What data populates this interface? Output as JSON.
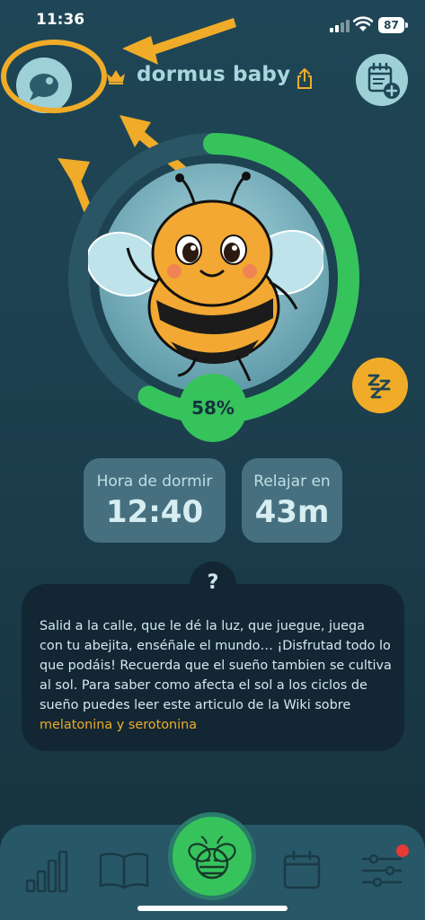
{
  "status_bar": {
    "time": "11:36",
    "battery": "87"
  },
  "header": {
    "title": "dormus baby",
    "chat_icon": "chat-bubble-icon",
    "crown_icon": "crown-icon",
    "share_icon": "share-icon",
    "calendar_add_icon": "calendar-add-icon"
  },
  "progress": {
    "percent_label": "58%",
    "percent_value": 0.58
  },
  "sleep_button": {
    "icon": "zzz-icon"
  },
  "cards": {
    "bedtime": {
      "label": "Hora de dormir",
      "value": "12:40"
    },
    "relax": {
      "label": "Relajar en",
      "value": "43m"
    }
  },
  "tip": {
    "question_mark": "?",
    "text": "Salid a la calle, que le dé la luz, que juegue, juega con tu abejita, enséñale el mundo… ¡Disfrutad todo lo que podáis! Recuerda que el sueño tambien se cultiva al sol. Para saber como afecta el sol a los ciclos de sueño puedes leer este articulo de la Wiki sobre ",
    "link": "melatonina y serotonina"
  },
  "tab_bar": {
    "items": [
      {
        "icon": "stats-icon"
      },
      {
        "icon": "book-icon"
      },
      {
        "icon": "bee-home-icon"
      },
      {
        "icon": "calendar-icon"
      },
      {
        "icon": "settings-sliders-icon"
      }
    ]
  },
  "colors": {
    "accent_green": "#36c35c",
    "accent_orange": "#f0ac28",
    "bg_teal": "#1f4656",
    "notification": "#e53a35"
  }
}
